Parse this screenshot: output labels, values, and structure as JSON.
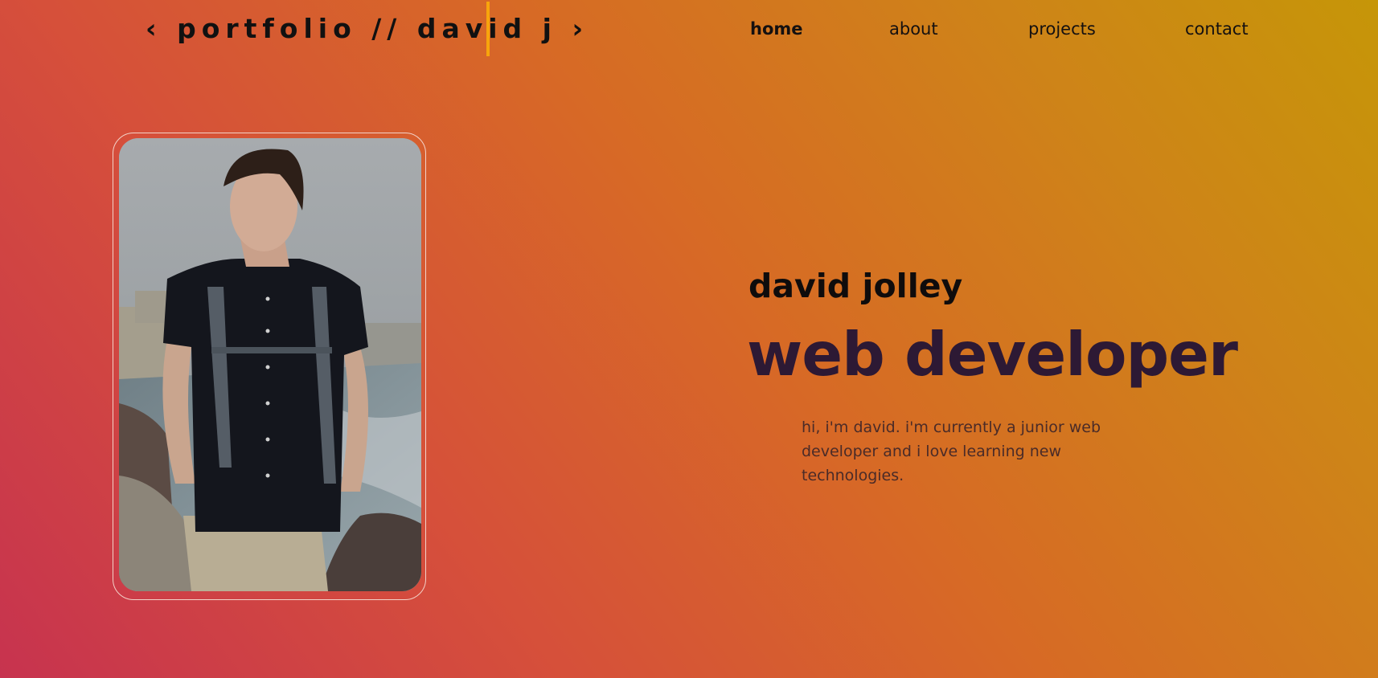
{
  "header": {
    "logo_text": "‹ portfolio // david j ›",
    "nav": [
      {
        "label": "home",
        "active": true
      },
      {
        "label": "about",
        "active": false
      },
      {
        "label": "projects",
        "active": false
      },
      {
        "label": "contact",
        "active": false
      }
    ]
  },
  "hero": {
    "name": "david jolley",
    "role": "web developer",
    "bio": "hi, i'm david. i'm currently a junior web developer and i love learning new technologies."
  },
  "colors": {
    "gradient_start": "#c7334f",
    "gradient_end": "#c69608",
    "cursor_accent": "#f7a40c",
    "role_text": "#2d1934"
  },
  "icons": [
    "cursor-caret"
  ]
}
